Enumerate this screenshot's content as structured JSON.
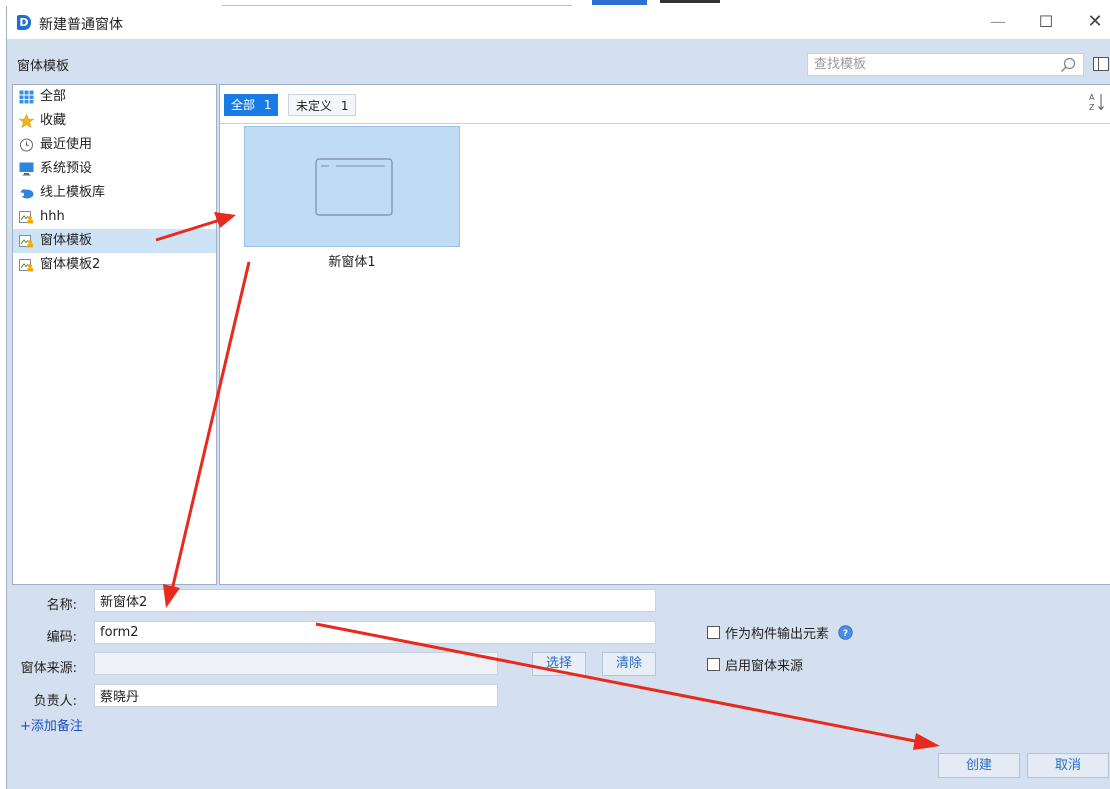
{
  "window": {
    "title": "新建普通窗体"
  },
  "section": {
    "title": "窗体模板"
  },
  "search": {
    "placeholder": "查找模板"
  },
  "sidebar": {
    "items": [
      {
        "label": "全部",
        "icon": "grid-icon"
      },
      {
        "label": "收藏",
        "icon": "star-icon"
      },
      {
        "label": "最近使用",
        "icon": "clock-icon"
      },
      {
        "label": "系统预设",
        "icon": "monitor-icon"
      },
      {
        "label": "线上模板库",
        "icon": "cloud-icon"
      },
      {
        "label": "hhh",
        "icon": "folder-user-icon"
      },
      {
        "label": "窗体模板",
        "icon": "folder-user-icon",
        "active": true
      },
      {
        "label": "窗体模板2",
        "icon": "folder-user-icon"
      }
    ]
  },
  "tabs": [
    {
      "label": "全部",
      "count": "1",
      "active": true
    },
    {
      "label": "未定义",
      "count": "1",
      "active": false
    }
  ],
  "templates": [
    {
      "name": "新窗体1"
    }
  ],
  "form": {
    "name_label": "名称:",
    "name_value": "新窗体2",
    "code_label": "编码:",
    "code_value": "form2",
    "source_label": "窗体来源:",
    "source_value": "",
    "owner_label": "负责人:",
    "owner_value": "蔡晓丹",
    "select_btn": "选择",
    "clear_btn": "清除",
    "export_component_label": "作为构件输出元素",
    "enable_source_label": "启用窗体来源",
    "add_note": "+添加备注"
  },
  "footer": {
    "create": "创建",
    "cancel": "取消"
  },
  "colors": {
    "accent": "#1b7be6",
    "selection": "#c0dcf5",
    "annotation_arrow": "#e8291c"
  }
}
